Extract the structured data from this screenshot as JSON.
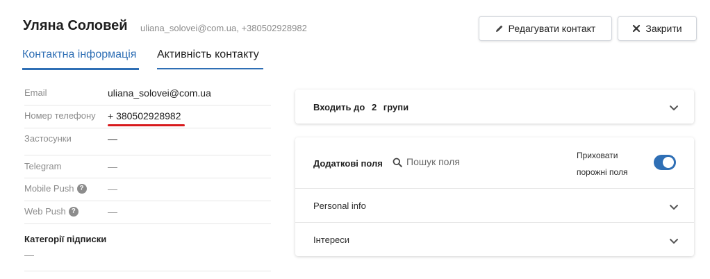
{
  "header": {
    "name": "Уляна Соловей",
    "subtitle": "uliana_solovei@com.ua, +380502928982",
    "edit_label": "Редагувати контакт",
    "close_label": "Закрити"
  },
  "tabs": [
    {
      "label": "Контактна інформація",
      "active": true
    },
    {
      "label": "Активність контакту",
      "active": false
    }
  ],
  "contact": {
    "email_label": "Email",
    "email_value": "uliana_solovei@com.ua",
    "phone_label": "Номер телефону",
    "phone_value": "+ 380502928982",
    "apps_label": "Застосунки",
    "apps_value": "—",
    "telegram_label": "Telegram",
    "telegram_value": "—",
    "mobile_push_label": "Mobile Push",
    "mobile_push_value": "—",
    "web_push_label": "Web Push",
    "web_push_value": "—",
    "categories_label": "Категорії підписки",
    "categories_value": "—"
  },
  "groups": {
    "prefix": "Входить до",
    "count": "2",
    "suffix": "групи"
  },
  "extra_fields": {
    "title": "Додаткові поля",
    "search_placeholder": "Пошук поля",
    "hide_empty_label_1": "Приховати",
    "hide_empty_label_2": "порожні поля",
    "hide_empty_enabled": true,
    "sections": [
      "Personal info",
      "Інтереси"
    ]
  },
  "colors": {
    "accent": "#2f6fb5",
    "highlight_underline": "#d8191c"
  }
}
